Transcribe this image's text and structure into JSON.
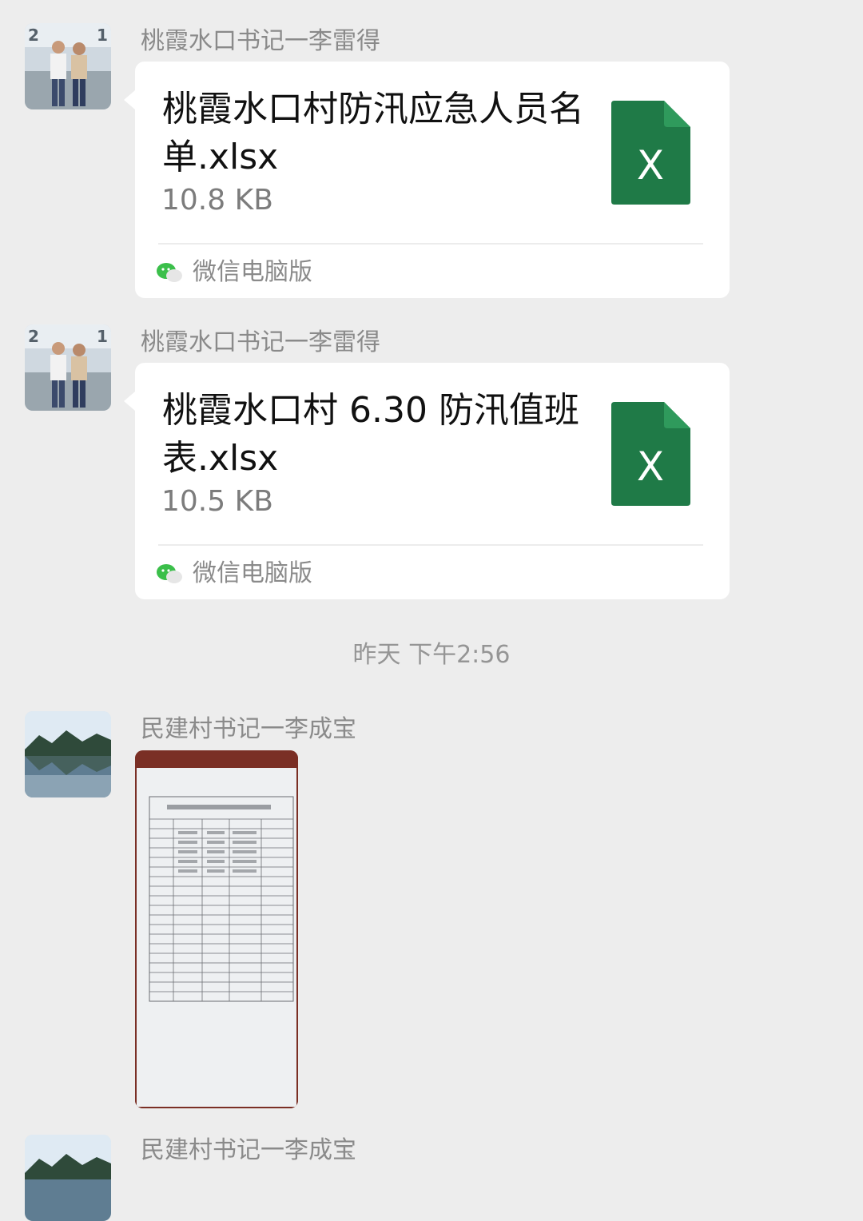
{
  "messages": [
    {
      "type": "file",
      "sender": "桃霞水口书记一李雷得",
      "file_name": "桃霞水口村防汛应急人员名单.xlsx",
      "file_size": "10.8 KB",
      "file_icon": "excel-icon",
      "file_icon_letter": "X",
      "source_label": "微信电脑版",
      "source_icon": "wechat-icon"
    },
    {
      "type": "file",
      "sender": "桃霞水口书记一李雷得",
      "file_name": "桃霞水口村 6.30 防汛值班表.xlsx",
      "file_size": "10.5 KB",
      "file_icon": "excel-icon",
      "file_icon_letter": "X",
      "source_label": "微信电脑版",
      "source_icon": "wechat-icon"
    },
    {
      "type": "timestamp",
      "text": "昨天 下午2:56"
    },
    {
      "type": "image",
      "sender": "民建村书记一李成宝"
    },
    {
      "type": "partial",
      "sender": "民建村书记一李成宝"
    }
  ],
  "colors": {
    "background": "#ededed",
    "bubble": "#ffffff",
    "excel_green": "#1f7a47",
    "excel_fold": "#2f9a5c",
    "wechat_green": "#3bbf4a"
  }
}
